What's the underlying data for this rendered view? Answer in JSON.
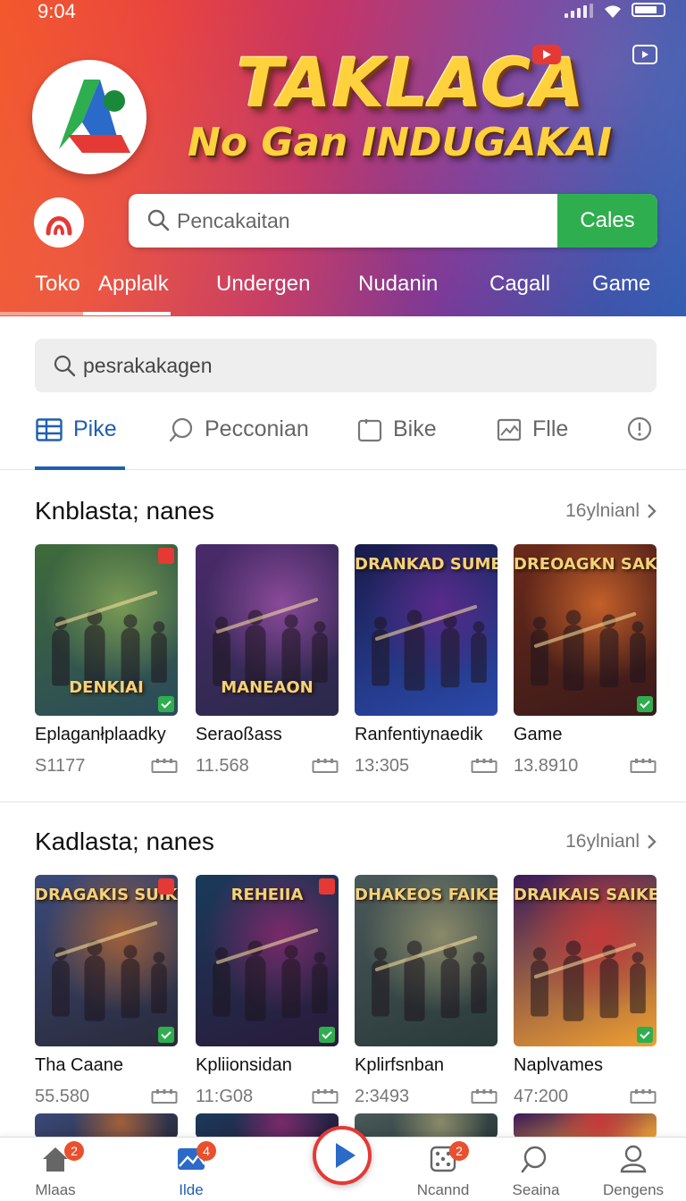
{
  "status_bar": {
    "time": "9:04"
  },
  "banner": {
    "title": "TAKLACA",
    "subtitle": "No Gan INDUGAKAI"
  },
  "header_search": {
    "placeholder": "Pencakaitan",
    "button_label": "Cales"
  },
  "header_tabs": [
    "Toko",
    "Applalk",
    "Undergen",
    "Nudanin",
    "Cagall",
    "Game"
  ],
  "main_search": {
    "placeholder": "pesrakakagen"
  },
  "category_tabs": [
    {
      "label": "Pike",
      "icon": "grid-icon",
      "active": true
    },
    {
      "label": "Pecconian",
      "icon": "chat-icon",
      "active": false
    },
    {
      "label": "Bike",
      "icon": "clipboard-icon",
      "active": false
    },
    {
      "label": "Flle",
      "icon": "image-icon",
      "active": false
    },
    {
      "label": "",
      "icon": "info-icon",
      "active": false
    }
  ],
  "sections": [
    {
      "title": "Knblasta; nanes",
      "more_label": "16ylnianl",
      "items": [
        {
          "name": "Eplaganłplaadky",
          "count": "S1177",
          "art_text": "DENKIAI",
          "palette": [
            "#3f6b3a",
            "#7a9a55",
            "#2b4a5a"
          ]
        },
        {
          "name": "Seraoßass",
          "count": "11.568",
          "art_text": "MANEAON",
          "palette": [
            "#4a2a6a",
            "#8a4a9a",
            "#2a2a4a"
          ]
        },
        {
          "name": "Ranfentiynaedik",
          "count": "13:305",
          "art_text": "DRANKAD SUME",
          "palette": [
            "#1a1a4a",
            "#5a2a8a",
            "#2a4aaa"
          ]
        },
        {
          "name": "Game",
          "count": "13.8910",
          "art_text": "DREOAGKN SAKE",
          "palette": [
            "#6a2a1a",
            "#c4602a",
            "#3a1a1a"
          ]
        }
      ]
    },
    {
      "title": "Kadlasta; nanes",
      "more_label": "16ylnianl",
      "items": [
        {
          "name": "Tha Caane",
          "count": "55.580",
          "art_text": "DRAGAKIS SUIKE",
          "palette": [
            "#3a4a7a",
            "#a0603a",
            "#2a2a3a"
          ]
        },
        {
          "name": "Kpliionsidan",
          "count": "11:G08",
          "art_text": "REHEIIA",
          "palette": [
            "#1a3a5a",
            "#7a2a6a",
            "#2a1a3a"
          ]
        },
        {
          "name": "Kplirfsnban",
          "count": "2:3493",
          "art_text": "DHAKEOS FAIKE",
          "palette": [
            "#4a5a5a",
            "#8a8a6a",
            "#2a3a3a"
          ]
        },
        {
          "name": "Naplvames",
          "count": "47:200",
          "art_text": "DRAIKAIS SAIKE",
          "palette": [
            "#3a1a5a",
            "#c43a3a",
            "#f0a030"
          ]
        }
      ]
    }
  ],
  "bottom_nav": [
    {
      "label": "Mlaas",
      "icon": "home-icon",
      "badge": "2",
      "active": false
    },
    {
      "label": "Ilde",
      "icon": "gallery-icon",
      "badge": "4",
      "active": true
    },
    {
      "label": "",
      "icon": "play-icon",
      "badge": "",
      "active": false
    },
    {
      "label": "Ncannd",
      "icon": "dice-icon",
      "badge": "2",
      "active": false
    },
    {
      "label": "Seaina",
      "icon": "search-icon",
      "badge": "",
      "active": false
    },
    {
      "label": "Dengens",
      "icon": "person-icon",
      "badge": "",
      "active": false
    }
  ],
  "colors": {
    "accent": "#1f5fb3",
    "search_button": "#2fae4f",
    "badge": "#e8502e"
  }
}
